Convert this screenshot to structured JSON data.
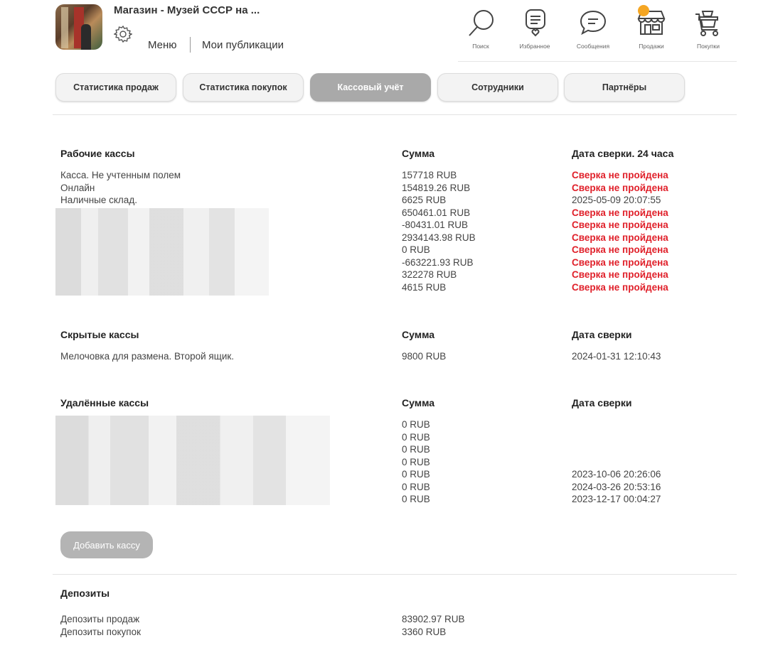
{
  "header": {
    "shop_title": "Магазин - Музей СССР на ...",
    "menu_label": "Меню",
    "publications_label": "Мои публикации",
    "nav": [
      {
        "label": "Поиск",
        "icon": "search-icon"
      },
      {
        "label": "Избранное",
        "icon": "favorites-icon"
      },
      {
        "label": "Сообщения",
        "icon": "messages-icon"
      },
      {
        "label": "Продажи",
        "icon": "sales-store-icon"
      },
      {
        "label": "Покупки",
        "icon": "purchases-cart-icon"
      }
    ],
    "accent_dot_color": "#f5a623"
  },
  "tabs": [
    {
      "label": "Статистика продаж",
      "active": false
    },
    {
      "label": "Статистика покупок",
      "active": false
    },
    {
      "label": "Кассовый учёт",
      "active": true
    },
    {
      "label": "Сотрудники",
      "active": false
    },
    {
      "label": "Партнёры",
      "active": false
    }
  ],
  "working": {
    "title": "Рабочие кассы",
    "amount_header": "Сумма",
    "date_header": "Дата сверки. 24 часа",
    "names": [
      "Касса. Не учтенным полем",
      "Онлайн",
      "Наличные склад."
    ],
    "amounts": [
      "157718  RUB",
      "154819.26  RUB",
      "6625  RUB",
      "650461.01  RUB",
      "-80431.01  RUB",
      "2934143.98  RUB",
      "0  RUB",
      "-663221.93  RUB",
      "322278  RUB",
      "4615  RUB"
    ],
    "statuses": [
      {
        "text": "Сверка не пройдена",
        "error": true
      },
      {
        "text": "Сверка не пройдена",
        "error": true
      },
      {
        "text": "2025-05-09 20:07:55",
        "error": false
      },
      {
        "text": "Сверка не пройдена",
        "error": true
      },
      {
        "text": "Сверка не пройдена",
        "error": true
      },
      {
        "text": "Сверка не пройдена",
        "error": true
      },
      {
        "text": "Сверка не пройдена",
        "error": true
      },
      {
        "text": "Сверка не пройдена",
        "error": true
      },
      {
        "text": "Сверка не пройдена",
        "error": true
      },
      {
        "text": "Сверка не пройдена",
        "error": true
      }
    ]
  },
  "hidden": {
    "title": "Скрытые кассы",
    "amount_header": "Сумма",
    "date_header": "Дата сверки",
    "name": "Мелочовка для размена. Второй ящик.",
    "amount": "9800 RUB",
    "date": "2024-01-31 12:10:43"
  },
  "deleted": {
    "title": "Удалённые кассы",
    "amount_header": "Сумма",
    "date_header": "Дата сверки",
    "amounts": [
      "0 RUB",
      "0 RUB",
      "0 RUB",
      "0 RUB",
      "0 RUB",
      "0 RUB",
      "0 RUB"
    ],
    "dates": [
      "",
      "",
      "",
      "",
      "2023-10-06 20:26:06",
      "2024-03-26 20:53:16",
      "2023-12-17 00:04:27"
    ]
  },
  "add_button_label": "Добавить кассу",
  "deposits": {
    "title": "Депозиты",
    "names": [
      "Депозиты продаж",
      "Депозиты покупок"
    ],
    "amounts": [
      "83902.97 RUB",
      "3360 RUB"
    ]
  },
  "colors": {
    "error": "#e0202a",
    "active_tab": "#a9a9a9"
  }
}
